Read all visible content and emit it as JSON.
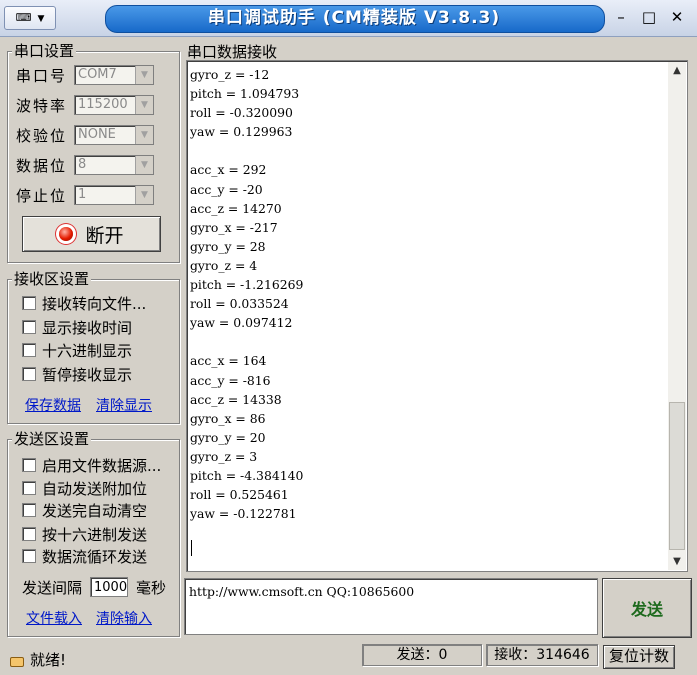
{
  "window": {
    "title": "串口调试助手 (CM精装版 V3.8.3)",
    "sysmenu_icon": "keyboard-icon",
    "minimize": "–",
    "maximize": "□",
    "close": "✕"
  },
  "serial_settings": {
    "title": "串口设置",
    "port_label": "串口号",
    "port_value": "COM7",
    "baud_label": "波特率",
    "baud_value": "115200",
    "parity_label": "校验位",
    "parity_value": "NONE",
    "databits_label": "数据位",
    "databits_value": "8",
    "stopbits_label": "停止位",
    "stopbits_value": "1",
    "open_close_button": "断开"
  },
  "recv_settings": {
    "title": "接收区设置",
    "options": [
      "接收转向文件...",
      "显示接收时间",
      "十六进制显示",
      "暂停接收显示"
    ],
    "save_link": "保存数据",
    "clear_link": "清除显示"
  },
  "send_settings": {
    "title": "发送区设置",
    "options": [
      "启用文件数据源...",
      "自动发送附加位",
      "发送完自动清空",
      "按十六进制发送",
      "数据流循环发送"
    ],
    "interval_label": "发送间隔",
    "interval_value": "1000",
    "interval_unit": "毫秒",
    "load_file_link": "文件载入",
    "clear_input_link": "清除输入"
  },
  "receive_area": {
    "title": "串口数据接收",
    "lines": [
      "gyro_z = -12",
      "pitch = 1.094793",
      "roll = -0.320090",
      "yaw = 0.129963",
      "",
      "acc_x = 292",
      "acc_y = -20",
      "acc_z = 14270",
      "gyro_x = -217",
      "gyro_y = 28",
      "gyro_z = 4",
      "pitch = -1.216269",
      "roll = 0.033524",
      "yaw = 0.097412",
      "",
      "acc_x = 164",
      "acc_y = -816",
      "acc_z = 14338",
      "gyro_x = 86",
      "gyro_y = 20",
      "gyro_z = 3",
      "pitch = -4.384140",
      "roll = 0.525461",
      "yaw = -0.122781"
    ]
  },
  "send_area": {
    "input_value": "http://www.cmsoft.cn QQ:10865600",
    "send_button": "发送"
  },
  "status_bar": {
    "ready_text": "就绪!",
    "sent": "发送：0",
    "received": "接收：314646",
    "reset_button": "复位计数"
  }
}
